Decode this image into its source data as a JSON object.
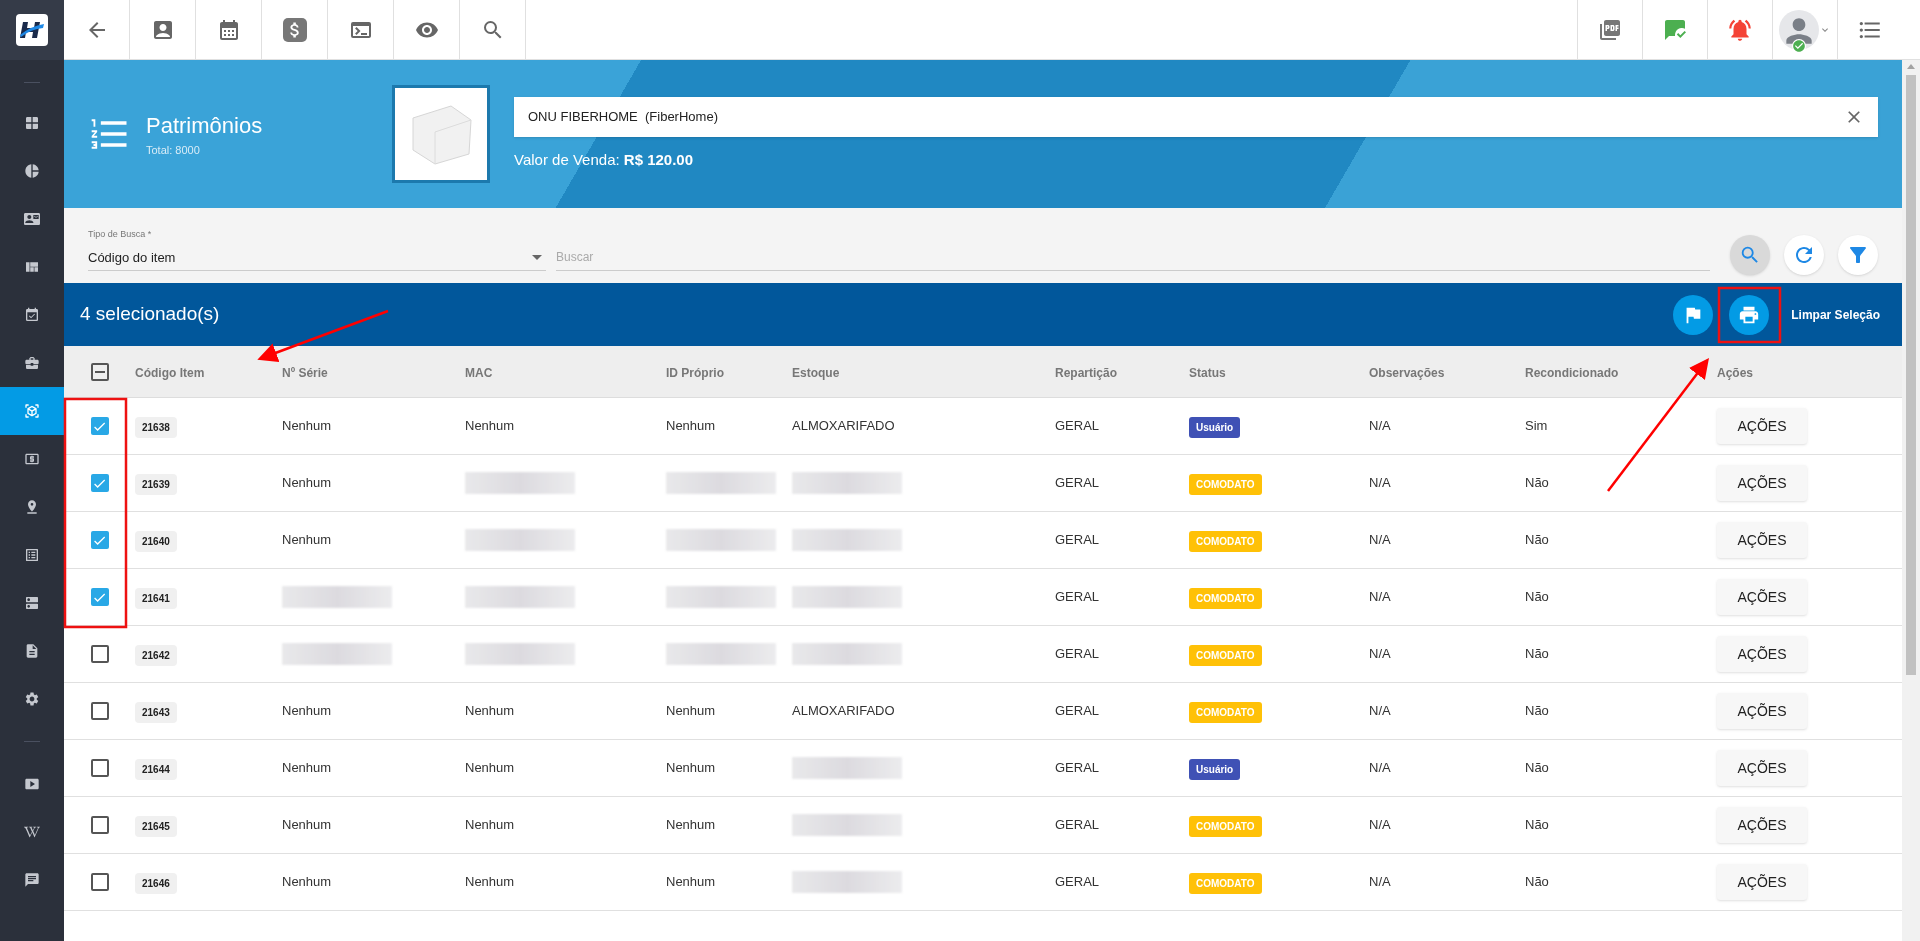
{
  "sidebar": {
    "items": [
      {
        "selected": false
      },
      {
        "selected": false
      },
      {
        "selected": false
      },
      {
        "selected": false
      },
      {
        "selected": false
      },
      {
        "selected": false
      },
      {
        "selected": true
      },
      {
        "selected": false
      },
      {
        "selected": false
      },
      {
        "selected": false
      },
      {
        "selected": false
      },
      {
        "selected": false
      },
      {
        "selected": false
      },
      {
        "selected": false
      },
      {
        "selected": false
      },
      {
        "selected": false
      }
    ]
  },
  "header": {
    "title": "Patrimônios",
    "total": "Total: 8000",
    "product_field": {
      "value": "ONU FIBERHOME  (FiberHome)"
    },
    "price": "Valor de Venda: **R$ 120.00**"
  },
  "search": {
    "type_label": "Tipo de Busca *",
    "type_value": "Código do item",
    "placeholder": "Buscar"
  },
  "selection_bar": {
    "count": "4 selecionado(s)",
    "clear": "Limpar Seleção"
  },
  "table": {
    "select_all": {
      "indeterminate": true
    },
    "columns": [
      "Código Item",
      "Nº Série",
      "MAC",
      "ID Próprio",
      "Estoque",
      "Repartição",
      "Status",
      "Observações",
      "Recondicionado",
      "Ações"
    ],
    "rows": [
      {
        "checked": true,
        "code": "21638",
        "serie": "Nenhum",
        "mac": "Nenhum",
        "id": "Nenhum",
        "estoque": "ALMOXARIFADO",
        "reparticao": "GERAL",
        "status": {
          "label": "Usuário",
          "color": "#3f51b5"
        },
        "obs": "N/A",
        "recond": "Sim",
        "action": "AÇÕES"
      },
      {
        "checked": true,
        "code": "21639",
        "serie": "Nenhum",
        "mac": null,
        "id": null,
        "estoque": null,
        "reparticao": "GERAL",
        "status": {
          "label": "COMODATO",
          "color": "#ffc107"
        },
        "obs": "N/A",
        "recond": "Não",
        "action": "AÇÕES"
      },
      {
        "checked": true,
        "code": "21640",
        "serie": "Nenhum",
        "mac": null,
        "id": null,
        "estoque": null,
        "reparticao": "GERAL",
        "status": {
          "label": "COMODATO",
          "color": "#ffc107"
        },
        "obs": "N/A",
        "recond": "Não",
        "action": "AÇÕES"
      },
      {
        "checked": true,
        "code": "21641",
        "serie": null,
        "mac": null,
        "id": null,
        "estoque": null,
        "reparticao": "GERAL",
        "status": {
          "label": "COMODATO",
          "color": "#ffc107"
        },
        "obs": "N/A",
        "recond": "Não",
        "action": "AÇÕES"
      },
      {
        "checked": false,
        "code": "21642",
        "serie": null,
        "mac": null,
        "id": null,
        "estoque": null,
        "reparticao": "GERAL",
        "status": {
          "label": "COMODATO",
          "color": "#ffc107"
        },
        "obs": "N/A",
        "recond": "Não",
        "action": "AÇÕES"
      },
      {
        "checked": false,
        "code": "21643",
        "serie": "Nenhum",
        "mac": "Nenhum",
        "id": "Nenhum",
        "estoque": "ALMOXARIFADO",
        "reparticao": "GERAL",
        "status": {
          "label": "COMODATO",
          "color": "#ffc107"
        },
        "obs": "N/A",
        "recond": "Não",
        "action": "AÇÕES"
      },
      {
        "checked": false,
        "code": "21644",
        "serie": "Nenhum",
        "mac": "Nenhum",
        "id": "Nenhum",
        "estoque": null,
        "reparticao": "GERAL",
        "status": {
          "label": "Usuário",
          "color": "#3f51b5"
        },
        "obs": "N/A",
        "recond": "Não",
        "action": "AÇÕES"
      },
      {
        "checked": false,
        "code": "21645",
        "serie": "Nenhum",
        "mac": "Nenhum",
        "id": "Nenhum",
        "estoque": null,
        "reparticao": "GERAL",
        "status": {
          "label": "COMODATO",
          "color": "#ffc107"
        },
        "obs": "N/A",
        "recond": "Não",
        "action": "AÇÕES"
      },
      {
        "checked": false,
        "code": "21646",
        "serie": "Nenhum",
        "mac": "Nenhum",
        "id": "Nenhum",
        "estoque": null,
        "reparticao": "GERAL",
        "status": {
          "label": "COMODATO",
          "color": "#ffc107"
        },
        "obs": "N/A",
        "recond": "Não",
        "action": "AÇÕES"
      }
    ]
  }
}
